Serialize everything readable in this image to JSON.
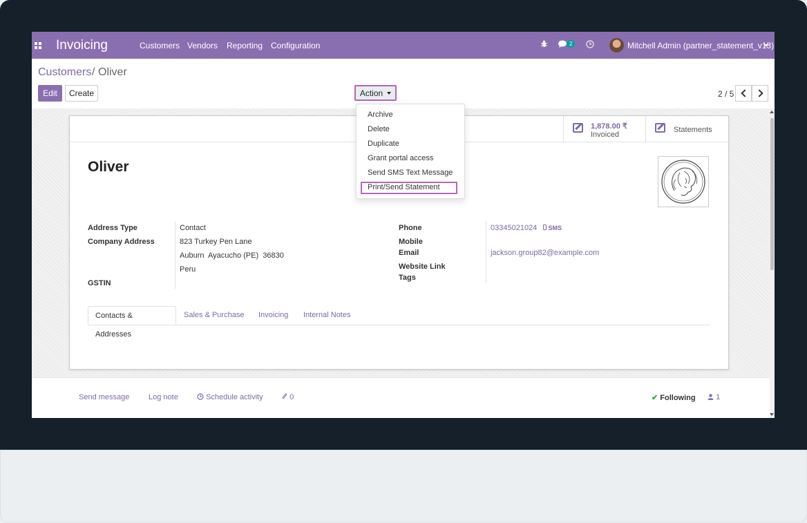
{
  "navbar": {
    "app_name": "Invoicing",
    "menus": [
      "Customers",
      "Vendors",
      "Reporting",
      "Configuration"
    ],
    "messages_badge": "2",
    "user": "Mitchell Admin (partner_statement_v13)"
  },
  "breadcrumb": {
    "parent": "Customers",
    "separator": "/",
    "current": "Oliver"
  },
  "toolbar": {
    "edit": "Edit",
    "create": "Create",
    "action": "Action"
  },
  "pager": {
    "text": "2 / 5"
  },
  "action_menu": [
    "Archive",
    "Delete",
    "Duplicate",
    "Grant portal access",
    "Send SMS Text Message",
    "Print/Send Statement"
  ],
  "smart_buttons": {
    "invoiced_value": "1,878.00 ₹",
    "invoiced_label": "Invoiced",
    "statements_label": "Statements"
  },
  "partner": {
    "name": "Oliver",
    "address_type_label": "Address Type",
    "address_type": "Contact",
    "company_address_label": "Company Address",
    "street": "823 Turkey Pen Lane",
    "city_line": "Auburn  Ayacucho (PE)  36830",
    "country": "Peru",
    "gstin_label": "GSTIN",
    "phone_label": "Phone",
    "phone": "03345021024",
    "sms": "SMS",
    "mobile_label": "Mobile",
    "email_label": "Email",
    "email": "jackson.group82@example.com",
    "website_label": "Website Link",
    "tags_label": "Tags"
  },
  "tabs": [
    "Contacts & Addresses",
    "Sales & Purchase",
    "Invoicing",
    "Internal Notes"
  ],
  "chatter": {
    "send_message": "Send message",
    "log_note": "Log note",
    "schedule_activity": "Schedule activity",
    "attachments": "0",
    "following": "Following",
    "followers": "1"
  },
  "colors": {
    "navbar": "#8a6fb0",
    "link": "#7c6aa8",
    "highlight": "#b366b9"
  }
}
